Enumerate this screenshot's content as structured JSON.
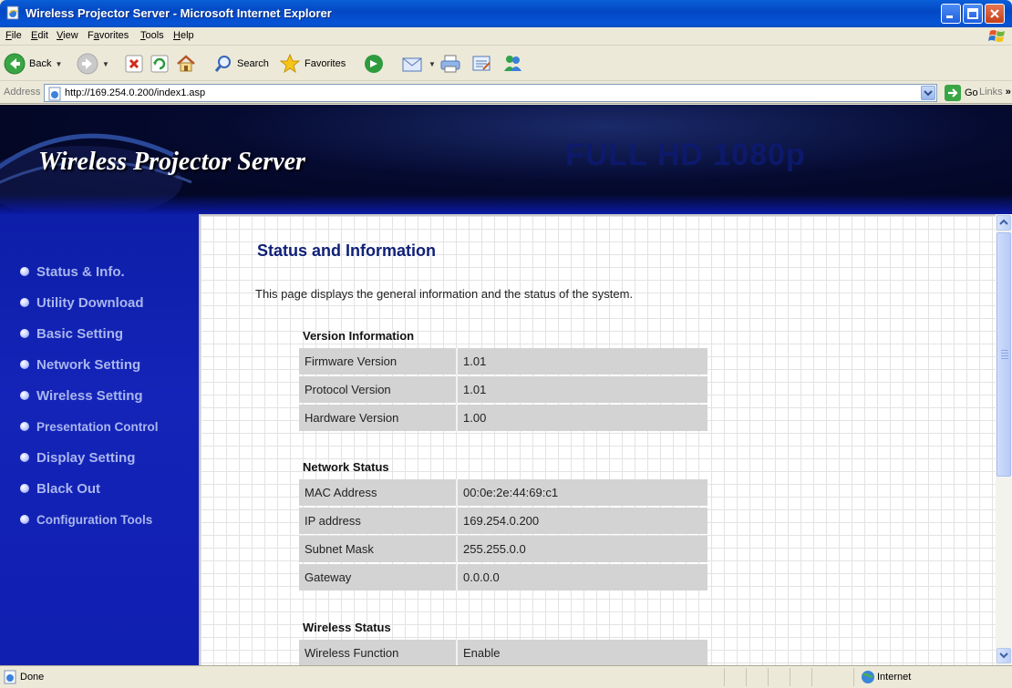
{
  "window": {
    "title": "Wireless Projector Server - Microsoft Internet Explorer"
  },
  "menu": {
    "items": [
      {
        "u": "F",
        "rest": "ile"
      },
      {
        "u": "E",
        "rest": "dit"
      },
      {
        "u": "V",
        "rest": "iew"
      },
      {
        "pre": "F",
        "u": "a",
        "rest": "vorites"
      },
      {
        "u": "T",
        "rest": "ools"
      },
      {
        "u": "H",
        "rest": "elp"
      }
    ]
  },
  "toolbar": {
    "back_label": "Back",
    "search_label": "Search",
    "favorites_label": "Favorites"
  },
  "address": {
    "label": "Address",
    "url": "http://169.254.0.200/index1.asp",
    "go_label": "Go",
    "links_label": "Links"
  },
  "banner": {
    "brand": "Wireless Projector Server",
    "ghost_text": "FULL HD 1080p"
  },
  "sidebar": {
    "items": [
      {
        "label": "Status & Info."
      },
      {
        "label": "Utility Download"
      },
      {
        "label": "Basic Setting"
      },
      {
        "label": "Network Setting"
      },
      {
        "label": "Wireless Setting"
      },
      {
        "label": "Presentation Control"
      },
      {
        "label": "Display Setting"
      },
      {
        "label": "Black Out"
      },
      {
        "label": "Configuration Tools"
      }
    ]
  },
  "main": {
    "heading": "Status and Information",
    "description": "This page displays the general information and the status of the system.",
    "sections": [
      {
        "title": "Version Information",
        "rows": [
          {
            "key": "Firmware Version",
            "value": "1.01"
          },
          {
            "key": "Protocol Version",
            "value": "1.01"
          },
          {
            "key": "Hardware Version",
            "value": "1.00"
          }
        ]
      },
      {
        "title": "Network Status",
        "rows": [
          {
            "key": "MAC Address",
            "value": "00:0e:2e:44:69:c1"
          },
          {
            "key": "IP address",
            "value": "169.254.0.200"
          },
          {
            "key": "Subnet Mask",
            "value": "255.255.0.0"
          },
          {
            "key": "Gateway",
            "value": "0.0.0.0"
          }
        ]
      },
      {
        "title": "Wireless Status",
        "rows": [
          {
            "key": "Wireless Function",
            "value": "Enable"
          }
        ]
      }
    ]
  },
  "status": {
    "text": "Done",
    "zone": "Internet"
  },
  "colors": {
    "titlebar": "#0348c4",
    "sidebar": "#1424b8",
    "heading": "#102078",
    "table_cell": "#d3d3d3"
  }
}
